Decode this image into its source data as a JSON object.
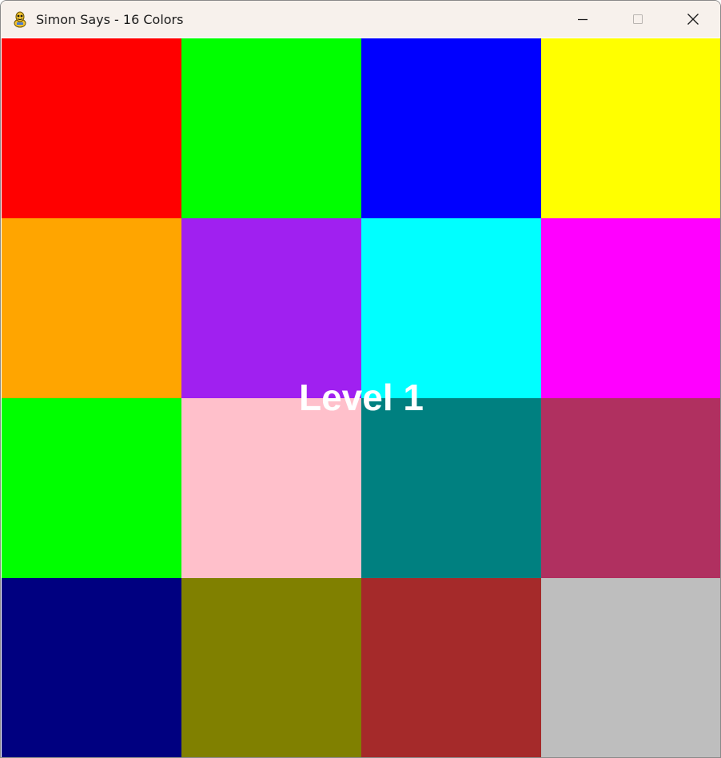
{
  "window": {
    "title": "Simon Says - 16 Colors",
    "app_icon": "pygame-snake-icon",
    "controls": [
      "minimize-icon",
      "maximize-icon",
      "close-icon"
    ]
  },
  "board": {
    "tiles": [
      {
        "name": "red",
        "color": "#ff0000"
      },
      {
        "name": "green",
        "color": "#00ff00"
      },
      {
        "name": "blue",
        "color": "#0000ff"
      },
      {
        "name": "yellow",
        "color": "#ffff00"
      },
      {
        "name": "orange",
        "color": "#ffa500"
      },
      {
        "name": "purple",
        "color": "#a020f0"
      },
      {
        "name": "cyan",
        "color": "#00ffff"
      },
      {
        "name": "magenta",
        "color": "#ff00ff"
      },
      {
        "name": "lime",
        "color": "#00ff00"
      },
      {
        "name": "pink",
        "color": "#ffc0cb"
      },
      {
        "name": "teal",
        "color": "#008080"
      },
      {
        "name": "maroon",
        "color": "#b03060"
      },
      {
        "name": "navy",
        "color": "#000080"
      },
      {
        "name": "olive",
        "color": "#808000"
      },
      {
        "name": "brown",
        "color": "#a52a2a"
      },
      {
        "name": "silver",
        "color": "#bebebe"
      }
    ]
  },
  "status": {
    "level_label": "Level 1",
    "level_color": "#ffffff"
  }
}
